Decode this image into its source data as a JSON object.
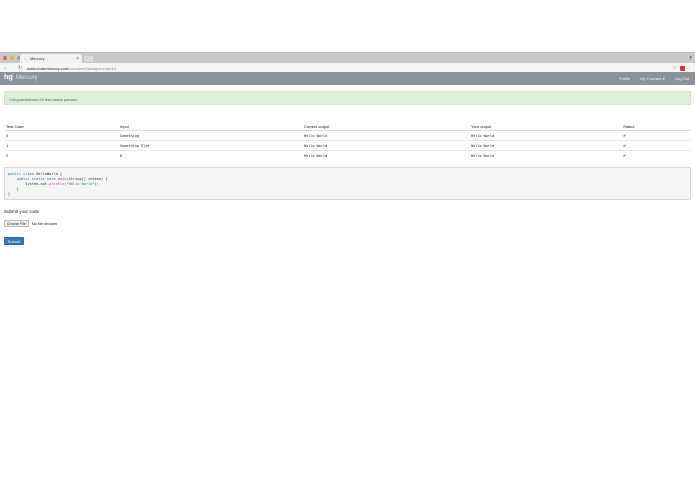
{
  "browser": {
    "tab_title": "Mercury",
    "url_domain": "www.codemercury.com",
    "url_path": "/courses/0/assignments/1/1"
  },
  "navbar": {
    "brand_logo": "hg",
    "brand_name": "Mercury",
    "items": [
      "Profile",
      "My Courses ▾",
      "Log Out"
    ]
  },
  "alert": {
    "text": "Congratulations! All test cases passed."
  },
  "table": {
    "headers": [
      "Test Case",
      "Input",
      "Correct output",
      "Your output",
      "Status"
    ],
    "rows": [
      {
        "case": "0",
        "input": "Something",
        "correct": "Hello World",
        "yours": "Hello World",
        "status": "✔"
      },
      {
        "case": "1",
        "input": "Something Else",
        "correct": "Hello World",
        "yours": "Hello World",
        "status": "✔"
      },
      {
        "case": "2",
        "input": "8",
        "correct": "Hello World",
        "yours": "Hello World",
        "status": "✔"
      }
    ]
  },
  "code": {
    "l1a": "public class",
    "l1b": " HelloWorld {",
    "l2a": "    public static void",
    "l2b": " main",
    "l2c": "(String[] cheese) {",
    "l3a": "        System.out.",
    "l3b": "println",
    "l3c": "(",
    "l3d": "\"Hello World\"",
    "l3e": ");",
    "l4": "    }",
    "l5": "}"
  },
  "submit": {
    "label": "Submit your code",
    "choose_label": "Choose File",
    "file_status": "No file chosen",
    "button_label": "Submit"
  }
}
